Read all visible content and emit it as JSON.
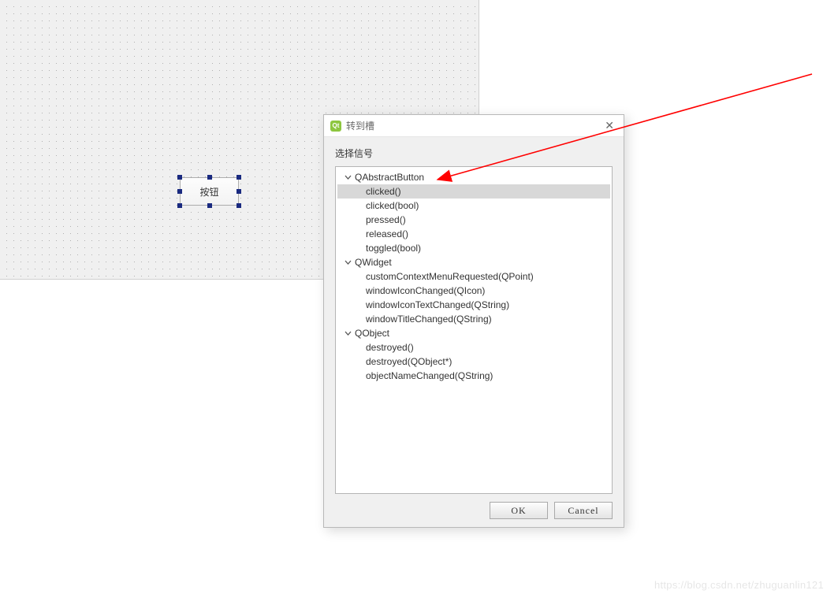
{
  "canvas": {
    "button_label": "按钮"
  },
  "dialog": {
    "title": "转到槽",
    "section_label": "选择信号",
    "groups": [
      {
        "name": "QAbstractButton",
        "signals": [
          {
            "label": "clicked()",
            "selected": true
          },
          {
            "label": "clicked(bool)"
          },
          {
            "label": "pressed()"
          },
          {
            "label": "released()"
          },
          {
            "label": "toggled(bool)"
          }
        ]
      },
      {
        "name": "QWidget",
        "signals": [
          {
            "label": "customContextMenuRequested(QPoint)"
          },
          {
            "label": "windowIconChanged(QIcon)"
          },
          {
            "label": "windowIconTextChanged(QString)"
          },
          {
            "label": "windowTitleChanged(QString)"
          }
        ]
      },
      {
        "name": "QObject",
        "signals": [
          {
            "label": "destroyed()"
          },
          {
            "label": "destroyed(QObject*)"
          },
          {
            "label": "objectNameChanged(QString)"
          }
        ]
      }
    ],
    "ok_label": "OK",
    "cancel_label": "Cancel"
  },
  "watermark": "https://blog.csdn.net/zhuguanlin121"
}
